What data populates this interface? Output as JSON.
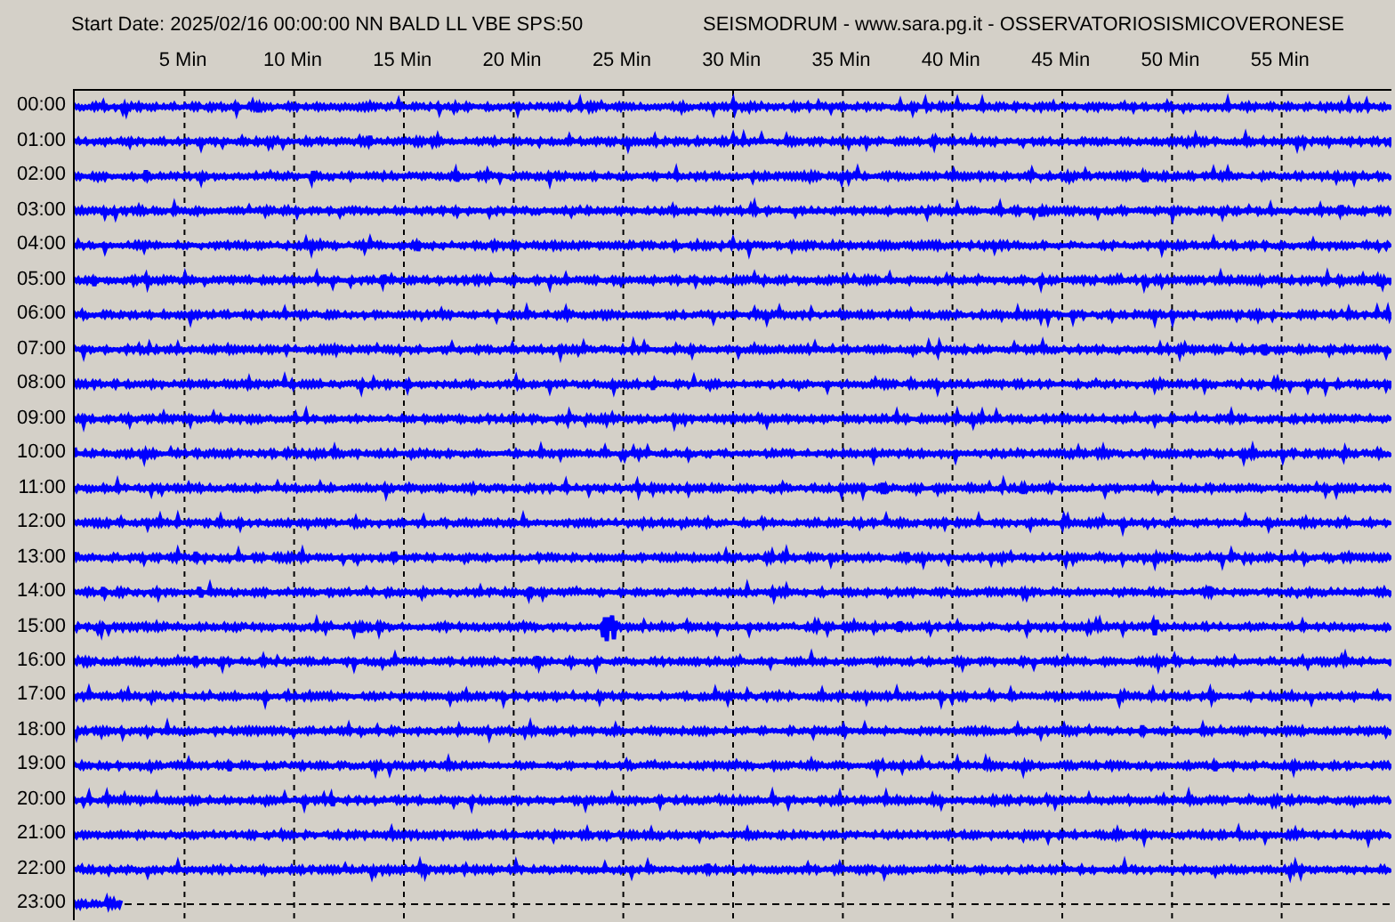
{
  "header": {
    "start_info": "Start Date: 2025/02/16 00:00:00 NN BALD LL VBE SPS:50",
    "title": "SEISMODRUM - www.sara.pg.it - OSSERVATORIOSISMICOVERONESE"
  },
  "minute_ticks": [
    "5 Min",
    "10 Min",
    "15 Min",
    "20 Min",
    "25 Min",
    "30 Min",
    "35 Min",
    "40 Min",
    "45 Min",
    "50 Min",
    "55 Min"
  ],
  "rows": [
    {
      "label": "00:00",
      "kind": "complete"
    },
    {
      "label": "01:00",
      "kind": "complete"
    },
    {
      "label": "02:00",
      "kind": "complete"
    },
    {
      "label": "03:00",
      "kind": "complete"
    },
    {
      "label": "04:00",
      "kind": "complete"
    },
    {
      "label": "05:00",
      "kind": "complete"
    },
    {
      "label": "06:00",
      "kind": "complete"
    },
    {
      "label": "07:00",
      "kind": "complete"
    },
    {
      "label": "08:00",
      "kind": "complete"
    },
    {
      "label": "09:00",
      "kind": "complete"
    },
    {
      "label": "10:00",
      "kind": "complete"
    },
    {
      "label": "11:00",
      "kind": "complete"
    },
    {
      "label": "12:00",
      "kind": "complete"
    },
    {
      "label": "13:00",
      "kind": "complete"
    },
    {
      "label": "14:00",
      "kind": "complete"
    },
    {
      "label": "15:00",
      "kind": "complete"
    },
    {
      "label": "16:00",
      "kind": "complete"
    },
    {
      "label": "17:00",
      "kind": "complete"
    },
    {
      "label": "18:00",
      "kind": "complete"
    },
    {
      "label": "19:00",
      "kind": "complete"
    },
    {
      "label": "20:00",
      "kind": "complete"
    },
    {
      "label": "21:00",
      "kind": "complete"
    },
    {
      "label": "22:00",
      "kind": "complete"
    },
    {
      "label": "23:00",
      "kind": "partial"
    }
  ]
}
